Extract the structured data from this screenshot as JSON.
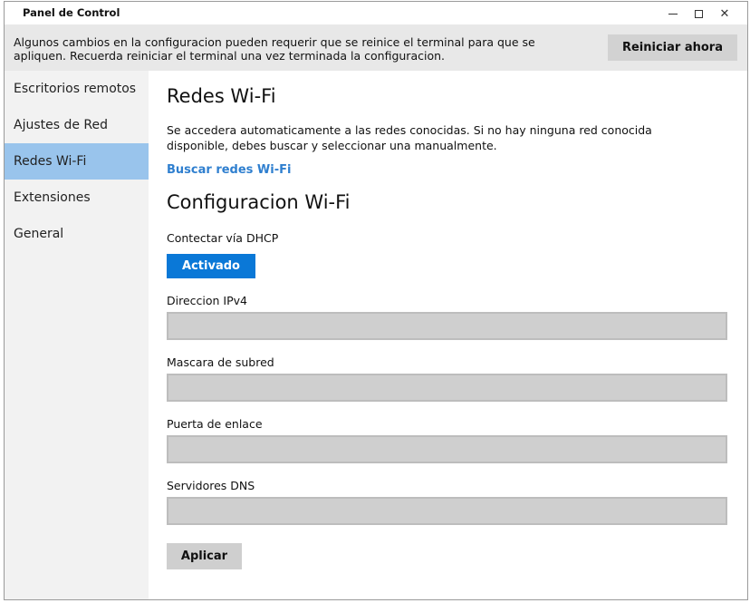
{
  "window": {
    "title": "Panel de Control",
    "controls": {
      "minimize": "minimize-icon",
      "maximize": "maximize-icon",
      "close": "close-icon",
      "close_glyph": "✕"
    }
  },
  "banner": {
    "message": "Algunos cambios en la configuracion pueden requerir que se reinice el terminal para que se apliquen. Recuerda reiniciar el terminal una vez terminada la configuracion.",
    "restart_label": "Reiniciar ahora"
  },
  "sidebar": {
    "items": [
      {
        "label": "Escritorios remotos",
        "active": false
      },
      {
        "label": "Ajustes de Red",
        "active": false
      },
      {
        "label": "Redes Wi-Fi",
        "active": true
      },
      {
        "label": "Extensiones",
        "active": false
      },
      {
        "label": "General",
        "active": false
      }
    ]
  },
  "main": {
    "heading": "Redes Wi-Fi",
    "description": "Se accedera automaticamente a las redes conocidas. Si no hay ninguna red conocida disponible, debes buscar y seleccionar una manualmente.",
    "search_link": "Buscar redes Wi-Fi",
    "config_heading": "Configuracion Wi-Fi",
    "dhcp_label": "Contectar vía DHCP",
    "dhcp_toggle": "Activado",
    "fields": {
      "ipv4_label": "Direccion IPv4",
      "ipv4_value": "",
      "mask_label": "Mascara de subred",
      "mask_value": "",
      "gateway_label": "Puerta de enlace",
      "gateway_value": "",
      "dns_label": "Servidores DNS",
      "dns_value": ""
    },
    "apply_label": "Aplicar"
  },
  "colors": {
    "accent": "#0a78d7",
    "active_sidebar": "#99c4ec",
    "link": "#2f7fcf",
    "banner_bg": "#e8e8e8",
    "sidebar_bg": "#f2f2f2"
  }
}
